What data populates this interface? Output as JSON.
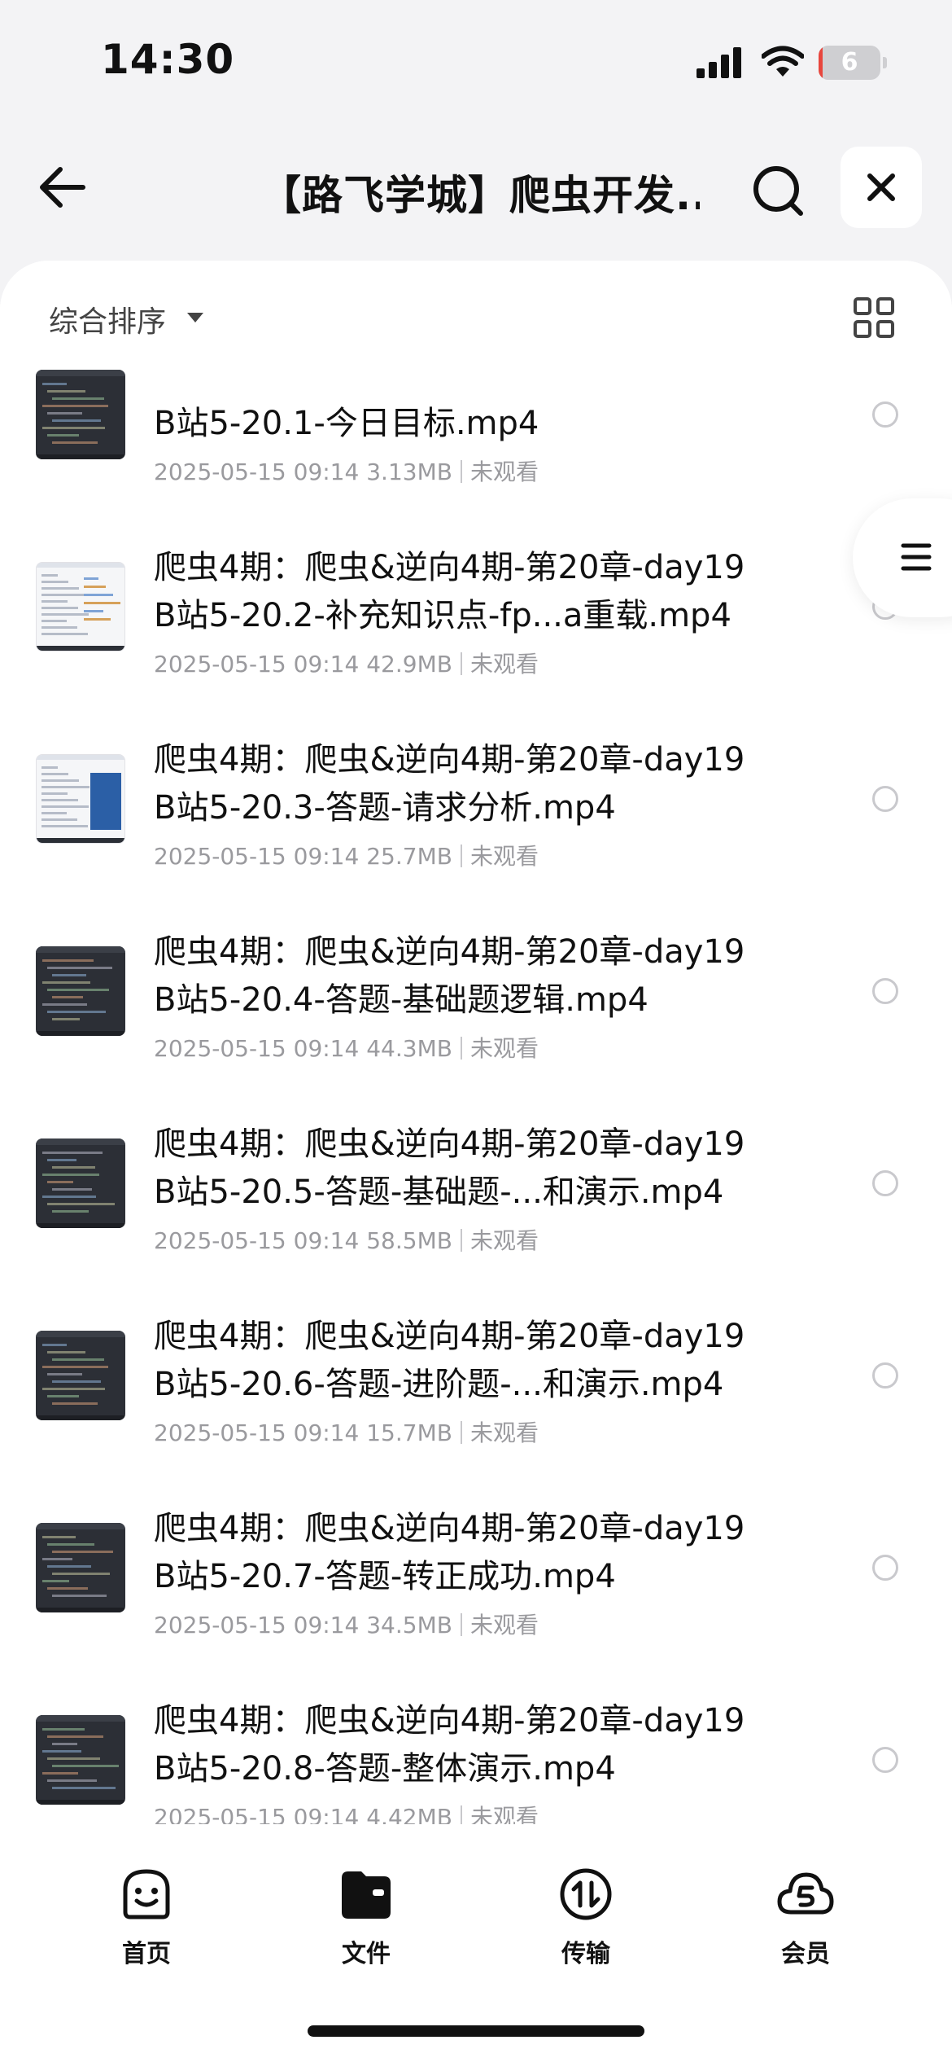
{
  "status_bar": {
    "time": "14:30",
    "battery_level": "6",
    "battery_fraction": 0.06,
    "icons": [
      "signal-icon",
      "wifi-icon",
      "battery-icon"
    ]
  },
  "nav": {
    "title": "【路飞学城】爬虫开发...",
    "icons": [
      "back-arrow-icon",
      "search-icon",
      "close-icon"
    ]
  },
  "toolbar": {
    "sort_label": "综合排序",
    "icons": [
      "caret-down-icon",
      "grid-view-icon"
    ]
  },
  "side_menu": {
    "icon": "menu-lines-icon"
  },
  "files": [
    {
      "line1": "",
      "line2": "B站5-20.1-今日目标.mp4",
      "date": "2025-05-15 09:14",
      "size": "3.13MB",
      "status": "未观看",
      "thumb": "dark"
    },
    {
      "line1": "爬虫4期：爬虫&逆向4期-第20章-day19",
      "line2": "B站5-20.2-补充知识点-fp...a重载.mp4",
      "date": "2025-05-15 09:14",
      "size": "42.9MB",
      "status": "未观看",
      "thumb": "light"
    },
    {
      "line1": "爬虫4期：爬虫&逆向4期-第20章-day19",
      "line2": "B站5-20.3-答题-请求分析.mp4",
      "date": "2025-05-15 09:14",
      "size": "25.7MB",
      "status": "未观看",
      "thumb": "light-blue"
    },
    {
      "line1": "爬虫4期：爬虫&逆向4期-第20章-day19",
      "line2": "B站5-20.4-答题-基础题逻辑.mp4",
      "date": "2025-05-15 09:14",
      "size": "44.3MB",
      "status": "未观看",
      "thumb": "dark"
    },
    {
      "line1": "爬虫4期：爬虫&逆向4期-第20章-day19",
      "line2": "B站5-20.5-答题-基础题-...和演示.mp4",
      "date": "2025-05-15 09:14",
      "size": "58.5MB",
      "status": "未观看",
      "thumb": "dark"
    },
    {
      "line1": "爬虫4期：爬虫&逆向4期-第20章-day19",
      "line2": "B站5-20.6-答题-进阶题-...和演示.mp4",
      "date": "2025-05-15 09:14",
      "size": "15.7MB",
      "status": "未观看",
      "thumb": "dark"
    },
    {
      "line1": "爬虫4期：爬虫&逆向4期-第20章-day19",
      "line2": "B站5-20.7-答题-转正成功.mp4",
      "date": "2025-05-15 09:14",
      "size": "34.5MB",
      "status": "未观看",
      "thumb": "dark"
    },
    {
      "line1": "爬虫4期：爬虫&逆向4期-第20章-day19",
      "line2": "B站5-20.8-答题-整体演示.mp4",
      "date": "2025-05-15 09:14",
      "size": "4.42MB",
      "status": "未观看",
      "thumb": "dark"
    }
  ],
  "tabs": [
    {
      "label": "首页",
      "icon": "smiley-face-icon"
    },
    {
      "label": "文件",
      "icon": "folder-icon"
    },
    {
      "label": "传输",
      "icon": "transfer-icon"
    },
    {
      "label": "会员",
      "icon": "member-cloud-icon"
    }
  ]
}
